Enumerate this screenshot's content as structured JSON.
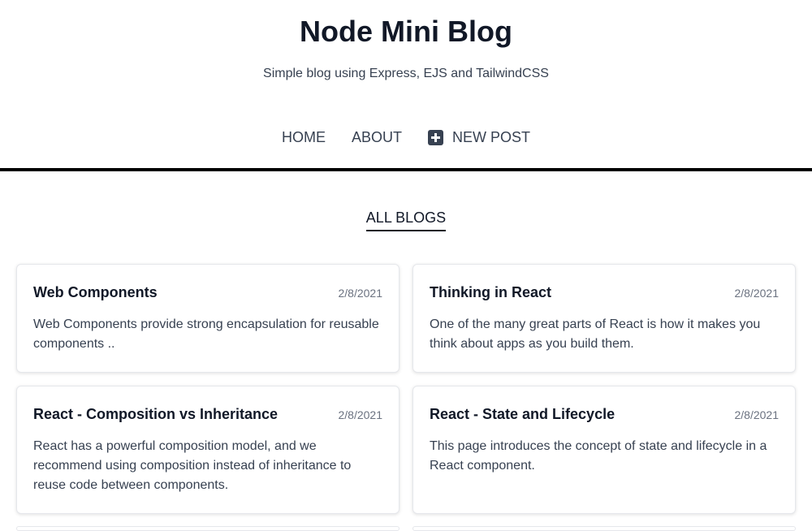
{
  "header": {
    "title": "Node Mini Blog",
    "subtitle": "Simple blog using Express, EJS and TailwindCSS"
  },
  "nav": {
    "home": "HOME",
    "about": "ABOUT",
    "new_post": "NEW POST",
    "new_post_icon": "plus-square-icon"
  },
  "section": {
    "heading": "ALL BLOGS"
  },
  "posts": [
    {
      "title": "Web Components",
      "date": "2/8/2021",
      "excerpt": "Web Components provide strong encapsulation for reusable components .."
    },
    {
      "title": "Thinking in React",
      "date": "2/8/2021",
      "excerpt": "One of the many great parts of React is how it makes you think about apps as you build them."
    },
    {
      "title": "React - Composition vs Inheritance",
      "date": "2/8/2021",
      "excerpt": "React has a powerful composition model, and we recommend using composition instead of inheritance to reuse code between components."
    },
    {
      "title": "React - State and Lifecycle",
      "date": "2/8/2021",
      "excerpt": "This page introduces the concept of state and lifecycle in a React component."
    }
  ]
}
